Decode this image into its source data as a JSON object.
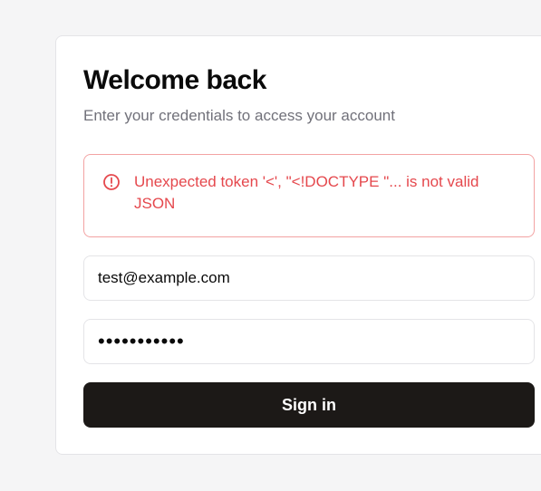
{
  "login": {
    "title": "Welcome back",
    "subtitle": "Enter your credentials to access your account",
    "error": {
      "icon": "alert-circle-icon",
      "message": "Unexpected token '<', \"<!DOCTYPE \"... is not valid JSON",
      "color": "#e5484d",
      "border_color": "#f3a3a3"
    },
    "email_field": {
      "value": "test@example.com"
    },
    "password_field": {
      "value": "•••••••••••"
    },
    "submit_label": "Sign in",
    "button_color": "#1c1917"
  }
}
